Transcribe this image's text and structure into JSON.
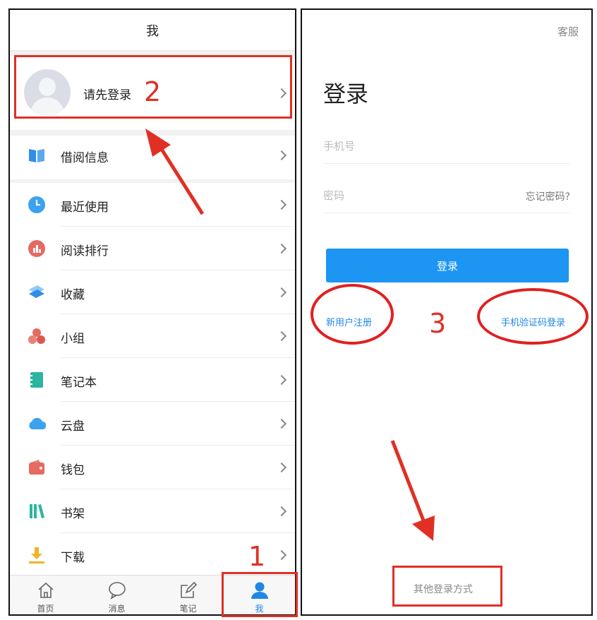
{
  "left": {
    "header_title": "我",
    "profile_label": "请先登录",
    "borrow_label": "借阅信息",
    "menu": [
      {
        "label": "最近使用",
        "icon": "clock-icon"
      },
      {
        "label": "阅读排行",
        "icon": "ranking-icon"
      },
      {
        "label": "收藏",
        "icon": "bookmark-icon"
      },
      {
        "label": "小组",
        "icon": "group-icon"
      },
      {
        "label": "笔记本",
        "icon": "notebook-icon"
      },
      {
        "label": "云盘",
        "icon": "cloud-icon"
      },
      {
        "label": "钱包",
        "icon": "wallet-icon"
      },
      {
        "label": "书架",
        "icon": "bookshelf-icon"
      },
      {
        "label": "下载",
        "icon": "download-icon"
      }
    ],
    "tabs": [
      {
        "label": "首页",
        "icon": "home-icon"
      },
      {
        "label": "消息",
        "icon": "message-icon"
      },
      {
        "label": "笔记",
        "icon": "note-edit-icon"
      },
      {
        "label": "我",
        "icon": "profile-icon",
        "active": true
      }
    ]
  },
  "right": {
    "support": "客服",
    "title": "登录",
    "phone_placeholder": "手机号",
    "password_placeholder": "密码",
    "forgot": "忘记密码?",
    "login_button": "登录",
    "register_link": "新用户注册",
    "sms_login_link": "手机验证码登录",
    "other_login": "其他登录方式"
  },
  "annotations": {
    "step1": "1",
    "step2": "2",
    "step3": "3"
  },
  "colors": {
    "accent_blue": "#1c95f3",
    "annotation_red": "#e03024"
  }
}
